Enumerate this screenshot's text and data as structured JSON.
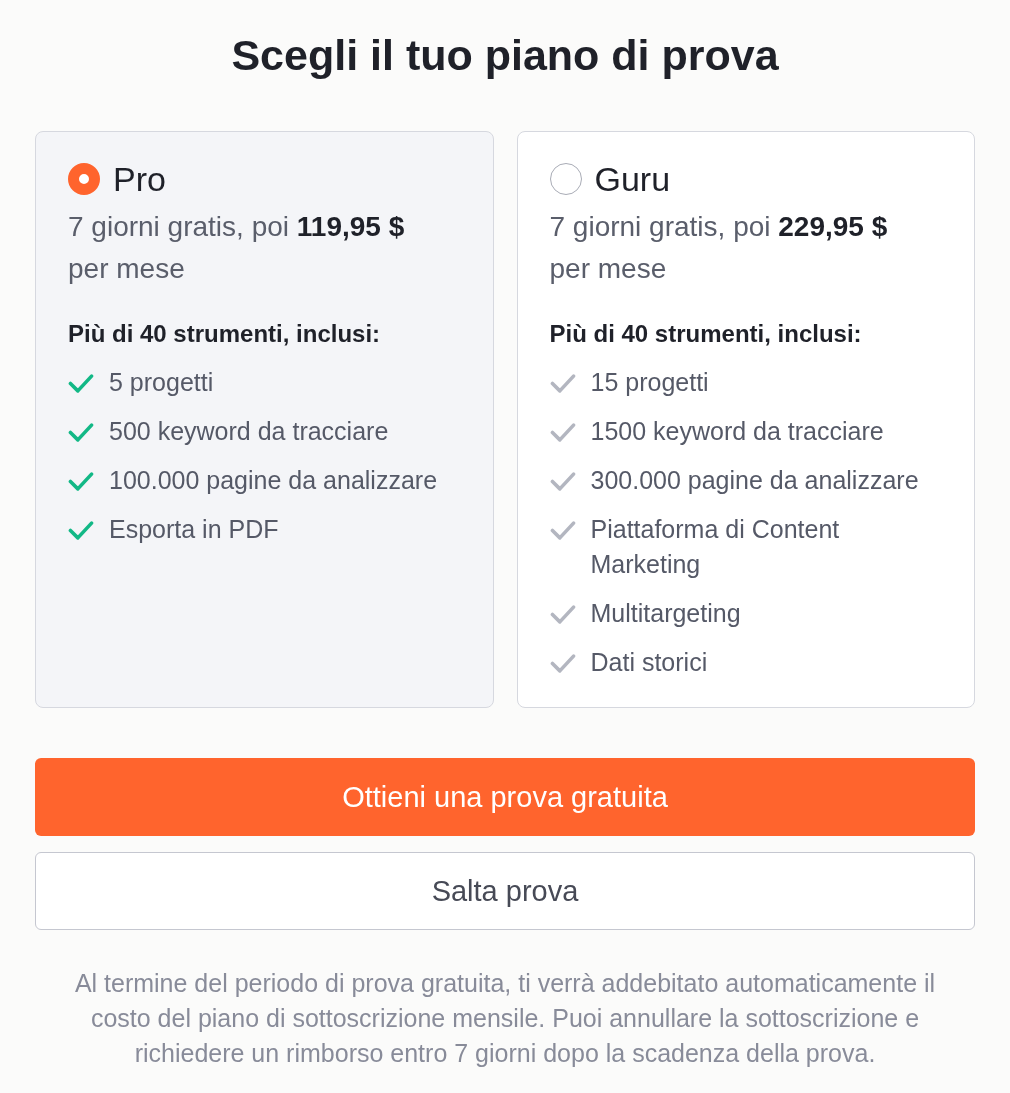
{
  "title": "Scegli il tuo piano di prova",
  "plans": [
    {
      "name": "Pro",
      "selected": true,
      "price": "7 giorni gratis, poi **119,95 $** per mese",
      "features_heading": "Più di 40 strumenti, inclusi:",
      "features": [
        "5 progetti",
        "500 keyword da tracciare",
        "100.000 pagine da analizzare",
        "Esporta in PDF"
      ]
    },
    {
      "name": "Guru",
      "selected": false,
      "price": "7 giorni gratis, poi **229,95 $** per mese",
      "features_heading": "Più di 40 strumenti, inclusi:",
      "features": [
        "15 progetti",
        "1500 keyword da tracciare",
        "300.000 pagine da analizzare",
        "Piattaforma di Content Marketing",
        "Multitargeting",
        "Dati storici"
      ]
    }
  ],
  "buttons": [
    {
      "kind": "primary",
      "label": "Ottieni una prova gratuita"
    },
    {
      "kind": "secondary",
      "label": "Salta prova"
    }
  ],
  "disclaimer": "Al termine del periodo di prova gratuita, ti verrà addebitato automaticamente il costo del piano di sottoscrizione mensile. Puoi annullare la sottoscrizione e richiedere un rimborso entro 7 giorni dopo la scadenza della prova."
}
